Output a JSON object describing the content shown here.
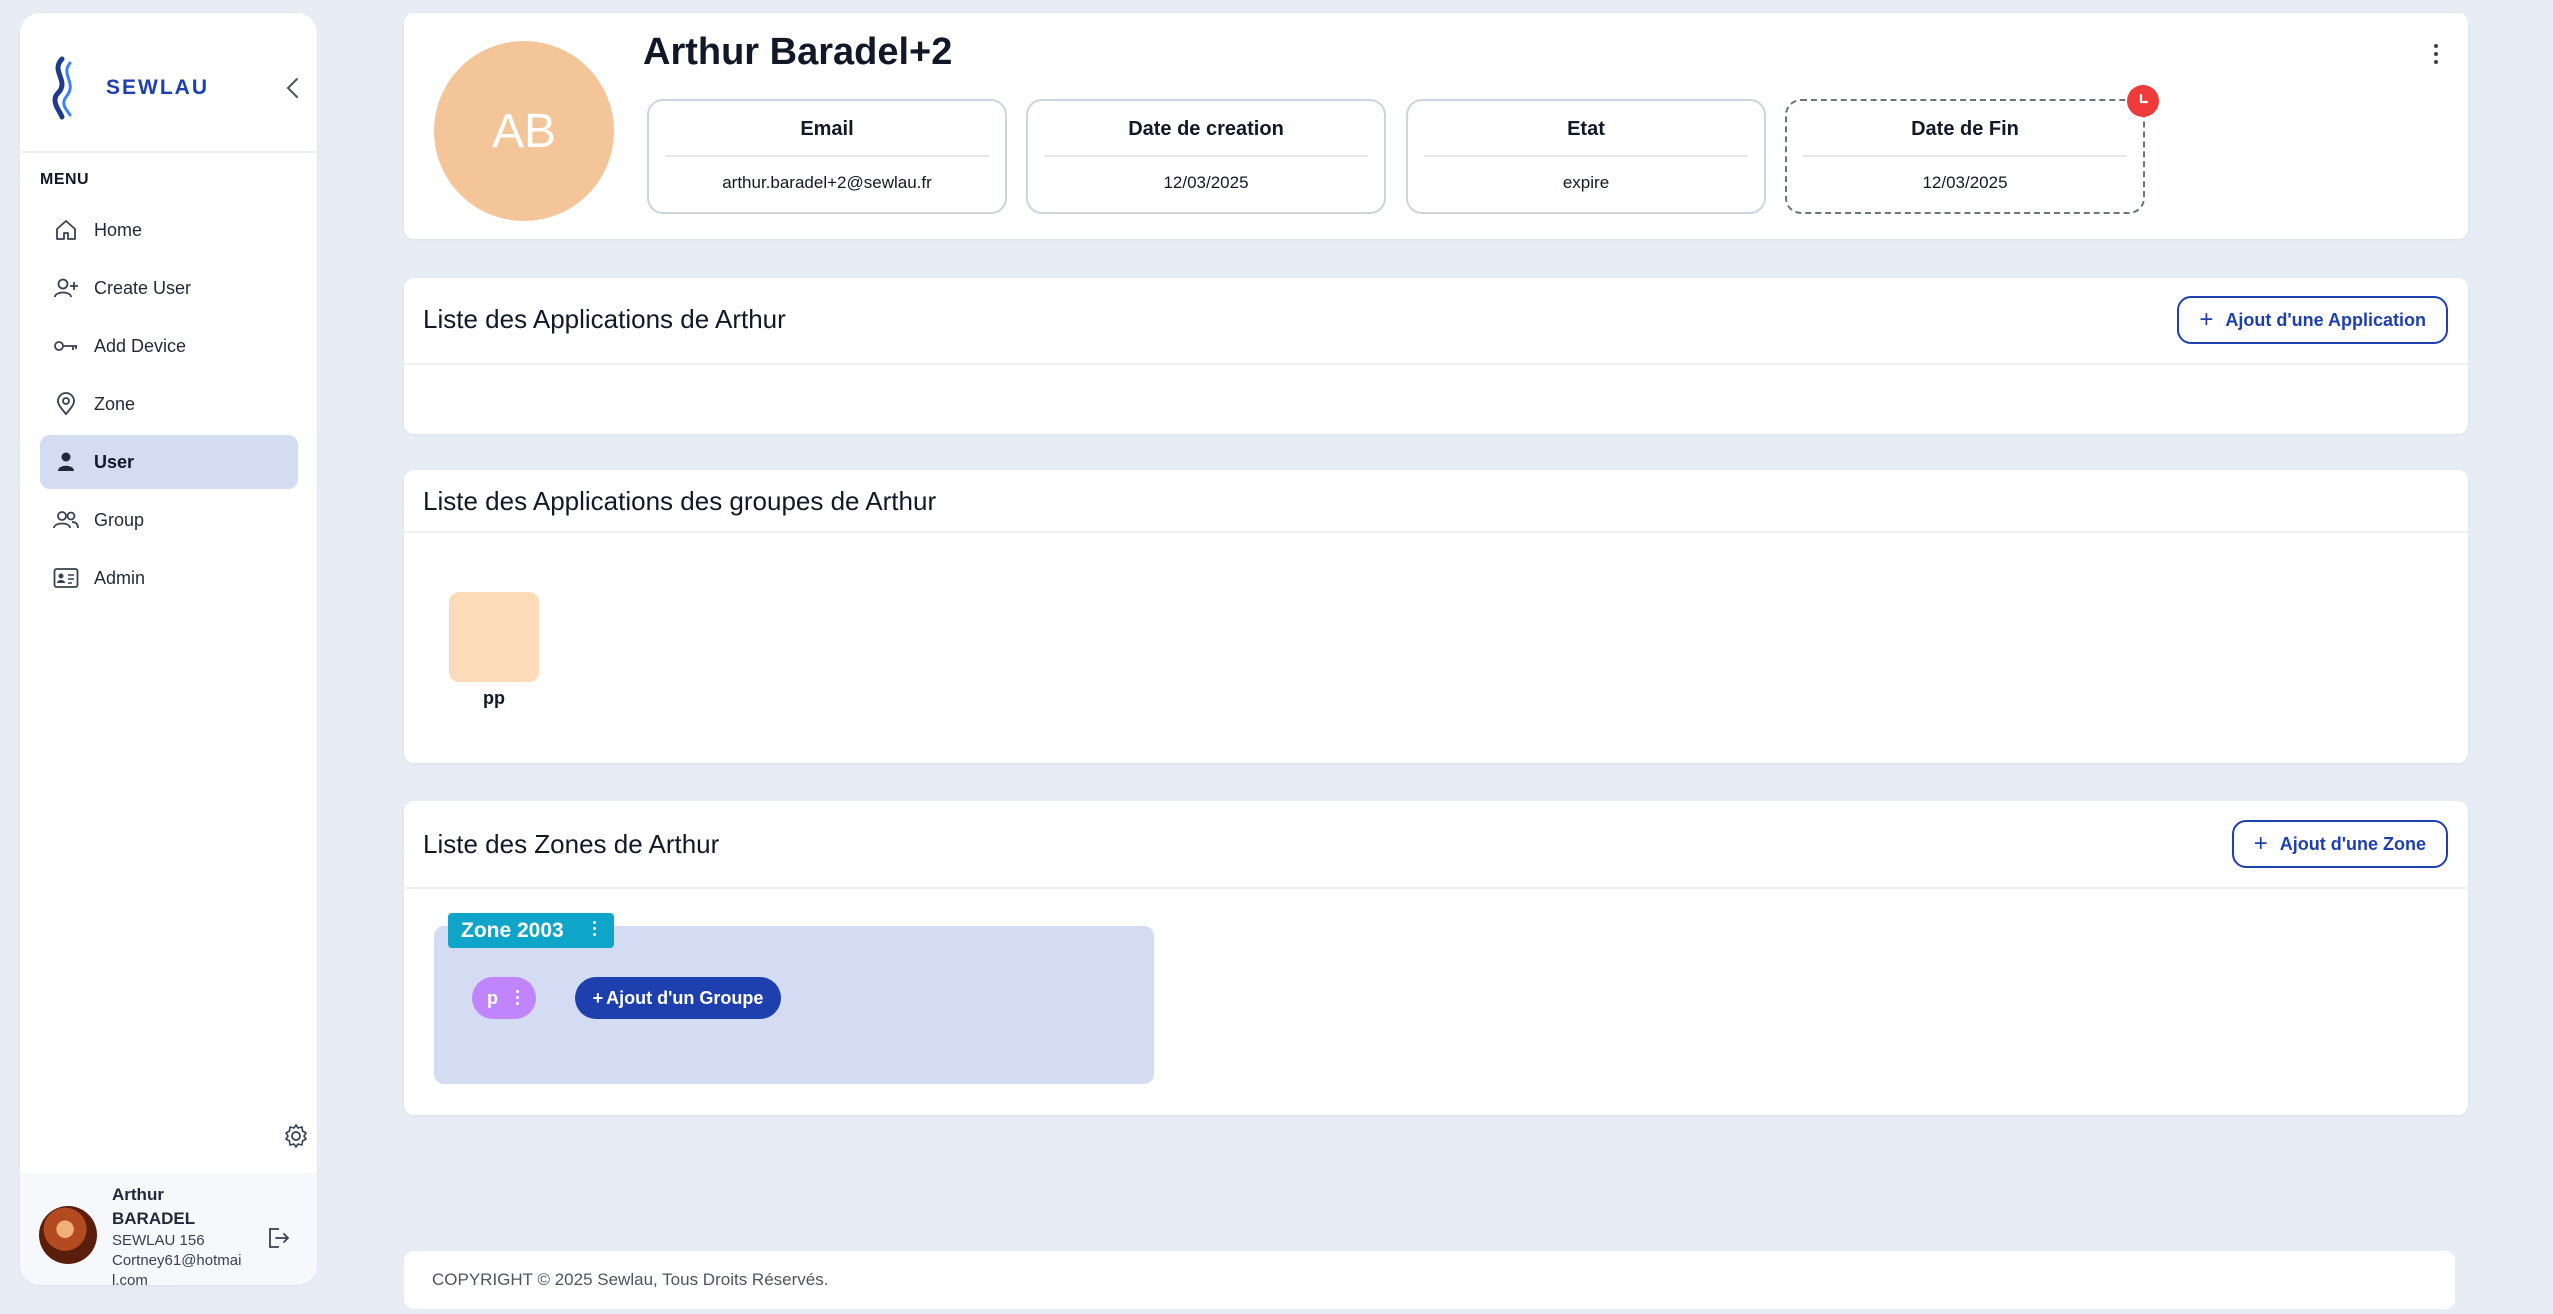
{
  "brand": {
    "name": "SEWLAU",
    "accent": "#1e40af"
  },
  "sidebar": {
    "menu_title": "MENU",
    "items": [
      {
        "label": "Home",
        "icon": "home-icon",
        "active": false
      },
      {
        "label": "Create User",
        "icon": "user-plus-icon",
        "active": false
      },
      {
        "label": "Add Device",
        "icon": "key-icon",
        "active": false
      },
      {
        "label": "Zone",
        "icon": "map-pin-icon",
        "active": false
      },
      {
        "label": "User",
        "icon": "user-icon",
        "active": true
      },
      {
        "label": "Group",
        "icon": "users-icon",
        "active": false
      },
      {
        "label": "Admin",
        "icon": "id-card-icon",
        "active": false
      }
    ],
    "current_user": {
      "name": "Arthur BARADEL",
      "org": "SEWLAU 156",
      "email": "Cortney61@hotmail.com"
    }
  },
  "profile": {
    "initials": "AB",
    "name": "Arthur Baradel+2",
    "fields": [
      {
        "label": "Email",
        "value": "arthur.baradel+2@sewlau.fr"
      },
      {
        "label": "Date de creation",
        "value": "12/03/2025"
      },
      {
        "label": "Etat",
        "value": "expire"
      },
      {
        "label": "Date de Fin",
        "value": "12/03/2025"
      }
    ]
  },
  "apps_section": {
    "title": "Liste des Applications de Arthur",
    "add_button": "Ajout d'une Application"
  },
  "group_apps_section": {
    "title": "Liste des Applications des groupes de Arthur",
    "apps": [
      {
        "label": "pp",
        "color": "#fddab8"
      }
    ]
  },
  "zones_section": {
    "title": "Liste des Zones de Arthur",
    "add_button": "Ajout d'une Zone",
    "zones": [
      {
        "name": "Zone 2003",
        "groups": [
          {
            "label": "p"
          }
        ],
        "add_group_button": "Ajout d'un Groupe"
      }
    ]
  },
  "footer": {
    "text": "COPYRIGHT © 2025 Sewlau, Tous Droits Réservés."
  }
}
